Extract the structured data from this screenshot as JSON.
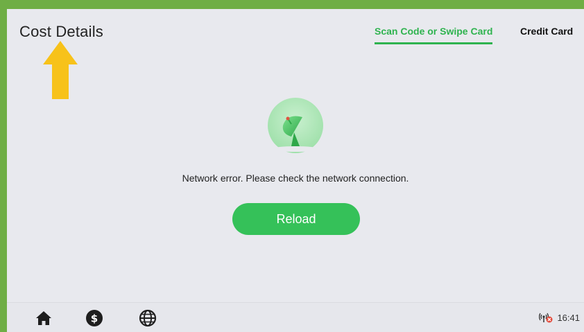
{
  "header": {
    "title": "Cost Details"
  },
  "tabs": [
    {
      "label": "Scan Code or Swipe Card",
      "active": true
    },
    {
      "label": "Credit Card",
      "active": false
    }
  ],
  "main": {
    "error_icon": "satellite-dish-icon",
    "error_message": "Network error. Please check the network connection.",
    "reload_label": "Reload"
  },
  "bottom_nav": {
    "items": [
      {
        "icon": "home-icon"
      },
      {
        "icon": "dollar-icon"
      },
      {
        "icon": "globe-icon"
      }
    ],
    "status": {
      "signal_icon": "no-signal-icon",
      "time": "16:41"
    }
  },
  "colors": {
    "accent": "#35c159",
    "frame": "#6fae45",
    "annotation_arrow": "#f7c21a",
    "background": "#e8e9ee"
  }
}
